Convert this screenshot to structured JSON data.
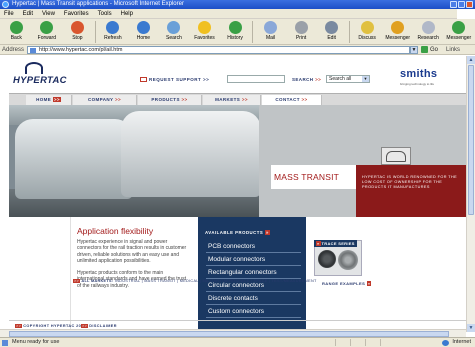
{
  "window": {
    "title": "Hypertac | Mass Transit applications - Microsoft Internet Explorer"
  },
  "menu": [
    "File",
    "Edit",
    "View",
    "Favorites",
    "Tools",
    "Help"
  ],
  "toolbar": {
    "buttons": [
      {
        "label": "Back",
        "icon": "back-arrow-icon",
        "color": "#3aa046"
      },
      {
        "label": "Forward",
        "icon": "forward-arrow-icon",
        "color": "#3aa046"
      },
      {
        "label": "Stop",
        "icon": "stop-icon",
        "color": "#d9562e"
      },
      {
        "label": "Refresh",
        "icon": "refresh-icon",
        "color": "#3a7ad0"
      },
      {
        "label": "Home",
        "icon": "home-icon",
        "color": "#3a7ad0"
      },
      {
        "label": "Search",
        "icon": "search-icon",
        "color": "#6aa0d8"
      },
      {
        "label": "Favorites",
        "icon": "star-icon",
        "color": "#f0c020"
      },
      {
        "label": "History",
        "icon": "history-icon",
        "color": "#3aa046"
      },
      {
        "label": "Mail",
        "icon": "mail-icon",
        "color": "#8aa8d8"
      },
      {
        "label": "Print",
        "icon": "printer-icon",
        "color": "#9aa0a8"
      },
      {
        "label": "Edit",
        "icon": "edit-icon",
        "color": "#7a8aa0"
      },
      {
        "label": "Discuss",
        "icon": "discuss-icon",
        "color": "#e0c040"
      },
      {
        "label": "Messenger",
        "icon": "messenger-icon",
        "color": "#e0a020"
      },
      {
        "label": "Research",
        "icon": "research-icon",
        "color": "#b0b8c8"
      },
      {
        "label": "Messenger",
        "icon": "messenger-people-icon",
        "color": "#3aa046"
      }
    ]
  },
  "address": {
    "label": "Address",
    "url": "http://www.hypertac.com/pl/ail.htm",
    "go_label": "Go",
    "links_label": "Links"
  },
  "page": {
    "logo_text": "HYPERTAC",
    "request_support": "REQUEST SUPPORT >>",
    "search_label": "SEARCH",
    "search_arrows": ">>",
    "search_select": "Search all",
    "brand": "smiths",
    "brand_sub": "bringing technology to life",
    "nav": [
      {
        "label": "HOME",
        "arrow": ">>"
      },
      {
        "label": "COMPANY",
        "arrow": ">>"
      },
      {
        "label": "PRODUCTS",
        "arrow": ">>"
      },
      {
        "label": "MARKETS",
        "arrow": ">>"
      },
      {
        "label": "CONTACT",
        "arrow": ">>"
      }
    ],
    "hero_title": "MASS TRANSIT",
    "hero_blurb": "HYPERTAC IS WORLD RENOWNED FOR THE LOW COST OF OWNERSHIP FOR THE PRODUCTS IT MANUFACTURES",
    "app_title": "Application flexibility",
    "para1": "Hypertac experience in signal and power connectors for the rail traction results in customer driven, reliable solutions with an easy use and unlimited application possibilities.",
    "para2": "Hypertac products conform to the main international standards and have earned the trust of the railways industry.",
    "products_header": "AVAILABLE PRODUCTS",
    "products_arrow": "»",
    "products": [
      "PCB connectors",
      "Modular connectors",
      "Rectangular connectors",
      "Circular connectors",
      "Discrete contacts",
      "Custom connectors"
    ],
    "trace_label": "TRACE SERIES",
    "trace_arrow": "»",
    "range_label": "RANGE EXAMPLES",
    "range_arrow": "»",
    "markets_arrow": ">>",
    "markets_label": "ALL MARKETS:",
    "markets_list": "INDUSTRIAL | MASS TRANSIT | MEDICAL | MILITARY/AEROSPACE | SPACE | TEST/MEASUREMENT",
    "copyright": "COPYRIGHT HYPERTAC 2005",
    "disclaimer": "DISCLAIMER",
    "footer_arrow": ">>"
  },
  "status": {
    "text": "Menu ready for use",
    "zone": "Internet"
  }
}
